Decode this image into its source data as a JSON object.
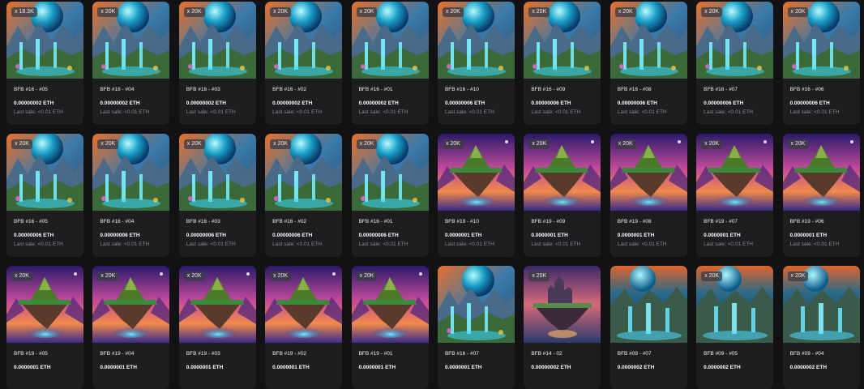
{
  "cards": [
    {
      "name": "BFB #16 - #05",
      "price": "0.00000002 ETH",
      "last_sale": "Last sale: <0.01 ETH",
      "qty": "x 18.3K",
      "art": "waterfall"
    },
    {
      "name": "BFB #16 - #04",
      "price": "0.00000002 ETH",
      "last_sale": "Last sale: <0.01 ETH",
      "qty": "x 20K",
      "art": "waterfall"
    },
    {
      "name": "BFB #16 - #03",
      "price": "0.00000002 ETH",
      "last_sale": "Last sale: <0.01 ETH",
      "qty": "x 20K",
      "art": "waterfall"
    },
    {
      "name": "BFB #16 - #02",
      "price": "0.00000002 ETH",
      "last_sale": "Last sale: <0.01 ETH",
      "qty": "x 20K",
      "art": "waterfall"
    },
    {
      "name": "BFB #16 - #01",
      "price": "0.00000002 ETH",
      "last_sale": "Last sale: <0.01 ETH",
      "qty": "x 20K",
      "art": "waterfall"
    },
    {
      "name": "BFB #16 - #10",
      "price": "0.00000006 ETH",
      "last_sale": "Last sale: <0.01 ETH",
      "qty": "x 20K",
      "art": "waterfall"
    },
    {
      "name": "BFB #16 - #09",
      "price": "0.00000006 ETH",
      "last_sale": "Last sale: <0.01 ETH",
      "qty": "x 20K",
      "art": "waterfall"
    },
    {
      "name": "BFB #16 - #08",
      "price": "0.00000006 ETH",
      "last_sale": "Last sale: <0.01 ETH",
      "qty": "x 20K",
      "art": "waterfall"
    },
    {
      "name": "BFB #16 - #07",
      "price": "0.00000006 ETH",
      "last_sale": "Last sale: <0.01 ETH",
      "qty": "x 20K",
      "art": "waterfall"
    },
    {
      "name": "BFB #16 - #06",
      "price": "0.00000006 ETH",
      "last_sale": "Last sale: <0.01 ETH",
      "qty": "x 20K",
      "art": "waterfall"
    },
    {
      "name": "BFB #16 - #05",
      "price": "0.00000006 ETH",
      "last_sale": "Last sale: <0.01 ETH",
      "qty": "x 20K",
      "art": "waterfall"
    },
    {
      "name": "BFB #16 - #04",
      "price": "0.00000006 ETH",
      "last_sale": "Last sale: <0.01 ETH",
      "qty": "x 20K",
      "art": "waterfall"
    },
    {
      "name": "BFB #16 - #03",
      "price": "0.00000006 ETH",
      "last_sale": "Last sale: <0.01 ETH",
      "qty": "x 20K",
      "art": "waterfall"
    },
    {
      "name": "BFB #16 - #02",
      "price": "0.00000006 ETH",
      "last_sale": "Last sale: <0.01 ETH",
      "qty": "x 20K",
      "art": "waterfall"
    },
    {
      "name": "BFB #16 - #01",
      "price": "0.00000006 ETH",
      "last_sale": "Last sale: <0.01 ETH",
      "qty": "x 20K",
      "art": "waterfall"
    },
    {
      "name": "BFB #19 - #10",
      "price": "0.0000001 ETH",
      "last_sale": "Last sale: <0.01 ETH",
      "qty": "x 20K",
      "art": "island"
    },
    {
      "name": "BFB #19 - #09",
      "price": "0.0000001 ETH",
      "last_sale": "Last sale: <0.01 ETH",
      "qty": "x 20K",
      "art": "island"
    },
    {
      "name": "BFB #19 - #08",
      "price": "0.0000001 ETH",
      "last_sale": "Last sale: <0.01 ETH",
      "qty": "x 20K",
      "art": "island"
    },
    {
      "name": "BFB #19 - #07",
      "price": "0.0000001 ETH",
      "last_sale": "Last sale: <0.01 ETH",
      "qty": "x 20K",
      "art": "island"
    },
    {
      "name": "BFB #19 - #06",
      "price": "0.0000001 ETH",
      "last_sale": "Last sale: <0.01 ETH",
      "qty": "x 20K",
      "art": "island"
    },
    {
      "name": "BFB #19 - #05",
      "price": "0.0000001 ETH",
      "last_sale": "",
      "qty": "x 20K",
      "art": "island"
    },
    {
      "name": "BFB #19 - #04",
      "price": "0.0000001 ETH",
      "last_sale": "",
      "qty": "x 20K",
      "art": "island"
    },
    {
      "name": "BFB #19 - #03",
      "price": "0.0000001 ETH",
      "last_sale": "",
      "qty": "x 20K",
      "art": "island"
    },
    {
      "name": "BFB #19 - #02",
      "price": "0.0000001 ETH",
      "last_sale": "",
      "qty": "x 20K",
      "art": "island"
    },
    {
      "name": "BFB #19 - #01",
      "price": "0.0000001 ETH",
      "last_sale": "",
      "qty": "x 20K",
      "art": "island"
    },
    {
      "name": "BFB #16 - #07",
      "price": "0.0000001 ETH",
      "last_sale": "",
      "qty": "",
      "art": "waterfall"
    },
    {
      "name": "BFB #14 - 02",
      "price": "0.00000002 ETH",
      "last_sale": "",
      "qty": "x 20K",
      "art": "castle"
    },
    {
      "name": "BFB #09 - #07",
      "price": "0.0000002 ETH",
      "last_sale": "",
      "qty": "",
      "art": "cascade"
    },
    {
      "name": "BFB #09 - #05",
      "price": "0.0000002 ETH",
      "last_sale": "",
      "qty": "x 20K",
      "art": "cascade"
    },
    {
      "name": "BFB #09 - #04",
      "price": "0.0000002 ETH",
      "last_sale": "",
      "qty": "x 20K",
      "art": "cascade"
    }
  ]
}
